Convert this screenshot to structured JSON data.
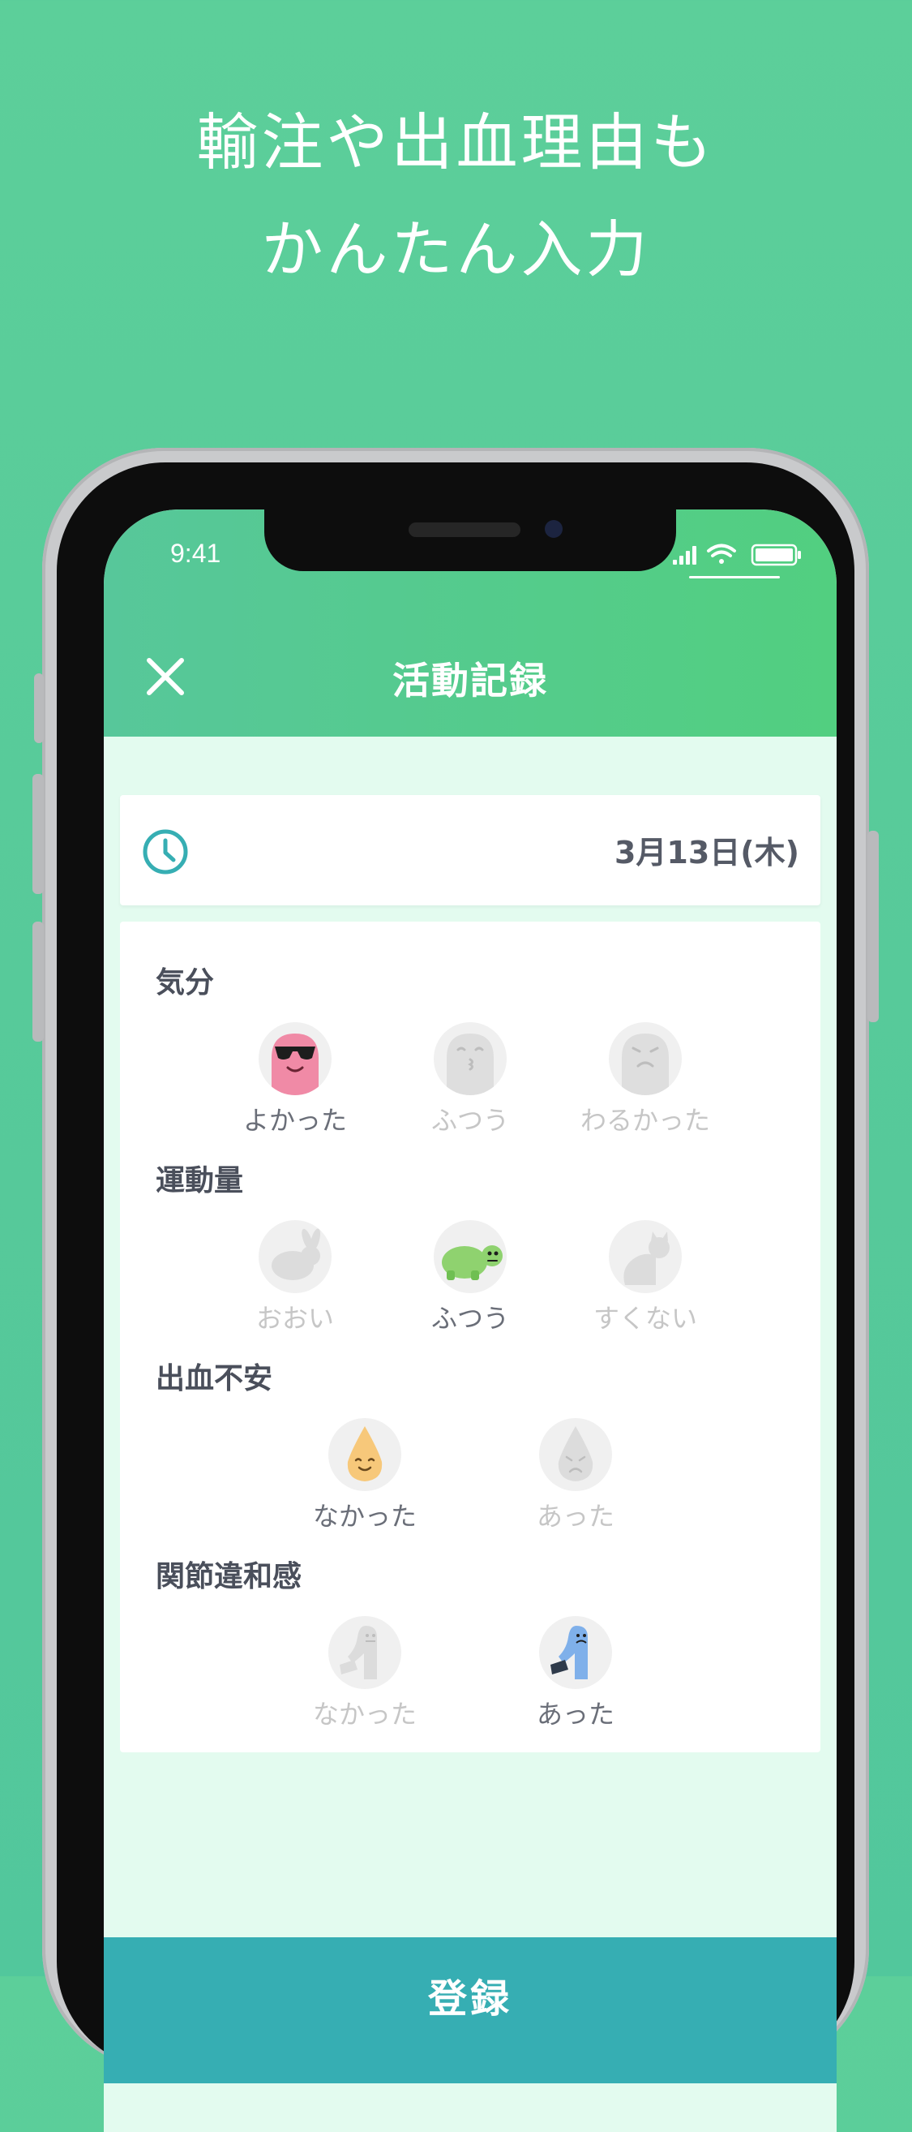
{
  "headline": {
    "line1": "輸注や出血理由も",
    "line2": "かんたん入力"
  },
  "status_bar": {
    "time": "9:41"
  },
  "header": {
    "title": "活動記録",
    "close_icon": "close-icon"
  },
  "date": {
    "text": "3月13日(木)",
    "icon": "clock-icon"
  },
  "sections": {
    "mood": {
      "label": "気分",
      "options": [
        {
          "label": "よかった",
          "selected": true,
          "icon": "pink-blob-sunglasses-icon"
        },
        {
          "label": "ふつう",
          "selected": false,
          "icon": "gray-blob-whistle-icon"
        },
        {
          "label": "わるかった",
          "selected": false,
          "icon": "gray-blob-sad-icon"
        }
      ]
    },
    "exercise": {
      "label": "運動量",
      "options": [
        {
          "label": "おおい",
          "selected": false,
          "icon": "rabbit-icon"
        },
        {
          "label": "ふつう",
          "selected": true,
          "icon": "turtle-icon"
        },
        {
          "label": "すくない",
          "selected": false,
          "icon": "cat-icon"
        }
      ]
    },
    "bleeding": {
      "label": "出血不安",
      "options": [
        {
          "label": "なかった",
          "selected": true,
          "icon": "drop-happy-icon"
        },
        {
          "label": "あった",
          "selected": false,
          "icon": "drop-sad-icon"
        }
      ]
    },
    "joint": {
      "label": "関節違和感",
      "options": [
        {
          "label": "なかった",
          "selected": false,
          "icon": "leg-fine-icon"
        },
        {
          "label": "あった",
          "selected": true,
          "icon": "leg-pain-icon"
        }
      ]
    }
  },
  "register_button": {
    "label": "登録"
  },
  "colors": {
    "background": "#56c99a",
    "header_start": "#57c79a",
    "header_end": "#52cf80",
    "register": "#36aeb3",
    "clock": "#36aeb3",
    "mood_selected": "#f08aa6",
    "turtle": "#8fd26f",
    "drop": "#f7c87a",
    "leg_pain": "#7fb0ea"
  }
}
